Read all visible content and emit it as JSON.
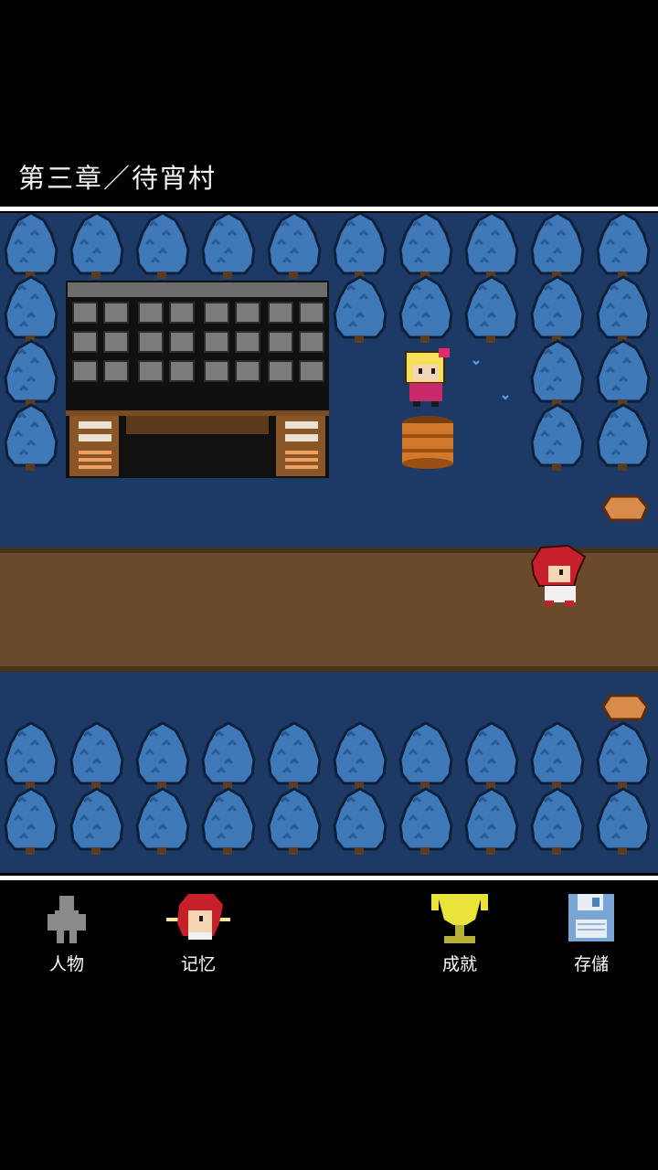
{
  "header": {
    "chapter_title": "第三章／待宵村"
  },
  "scene": {
    "background_color": "#1d3a66",
    "path_color": "#6b4a2c",
    "tree_color": "#3f79b8",
    "characters": [
      "blonde-girl",
      "red-haired-player"
    ]
  },
  "toolbar": {
    "items": [
      {
        "label": "人物",
        "icon": "person-silhouette-icon"
      },
      {
        "label": "记忆",
        "icon": "memory-portrait-icon"
      },
      {
        "label": "成就",
        "icon": "trophy-icon"
      },
      {
        "label": "存儲",
        "icon": "floppy-disk-icon"
      }
    ]
  }
}
